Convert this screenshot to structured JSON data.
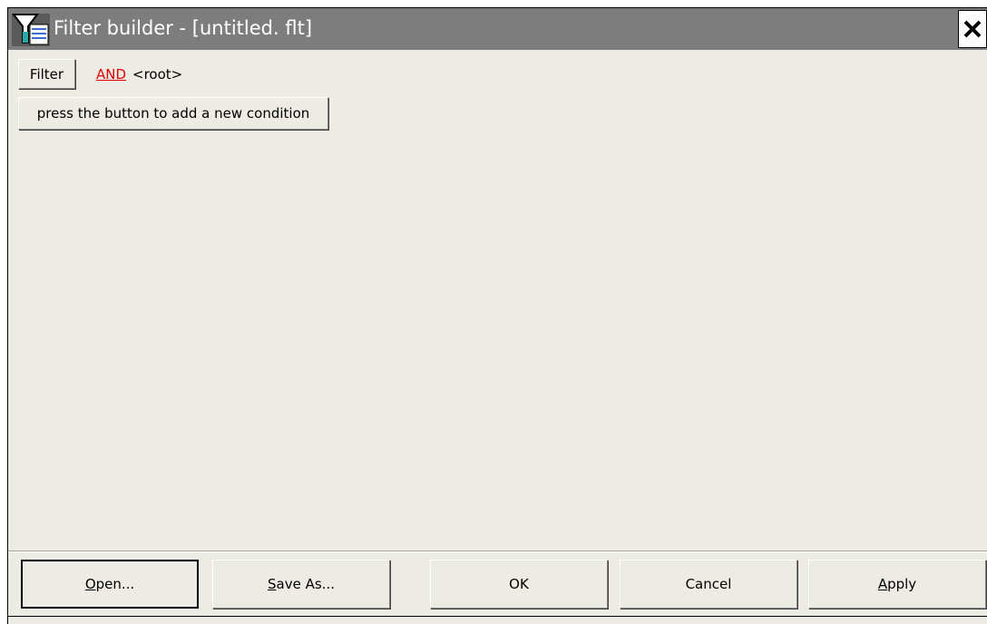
{
  "window": {
    "title": "Filter builder - [untitled. flt]",
    "icon": "filter-funnel-icon",
    "close_icon": "close-icon"
  },
  "toolbar": {
    "filter_label": "Filter",
    "operator_label": "AND",
    "root_label": "<root>"
  },
  "conditions": {
    "add_label": "press the button to add a new condition"
  },
  "buttons": {
    "open": "Open...",
    "save_as": "Save As...",
    "ok": "OK",
    "cancel": "Cancel",
    "apply": "Apply"
  },
  "colors": {
    "titlebar": "#7d7d7d",
    "window_bg": "#ecebe4",
    "operator": "#e00000"
  }
}
